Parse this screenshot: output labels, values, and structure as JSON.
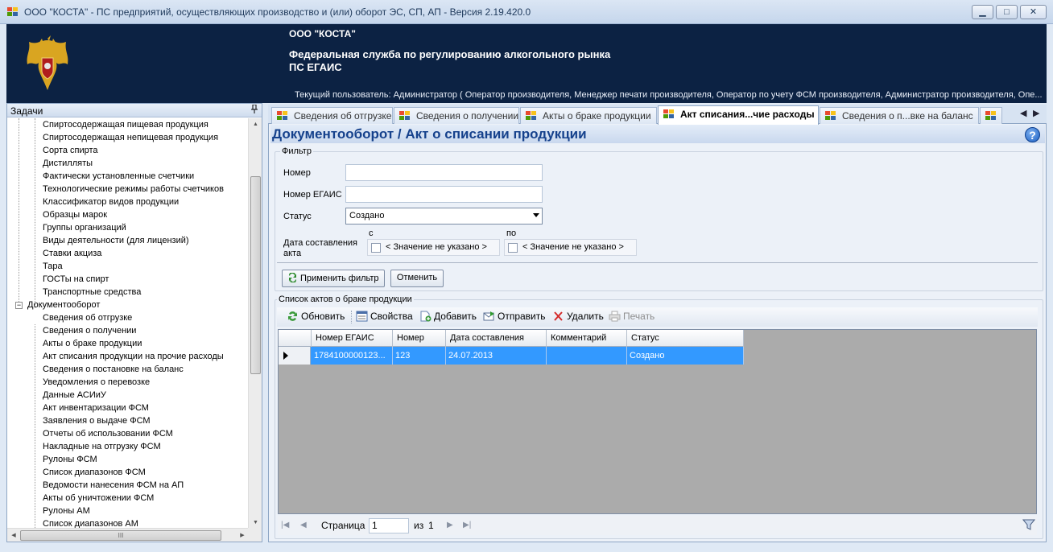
{
  "window": {
    "title": "ООО \"КОСТА\" - ПС предприятий, осуществляющих производство и (или) оборот ЭС, СП, АП - Версия 2.19.420.0",
    "minimize_glyph": "▁",
    "maximize_glyph": "□",
    "close_glyph": "✕"
  },
  "banner": {
    "company": "ООО \"КОСТА\"",
    "agency_line1": "Федеральная служба по регулированию алкогольного рынка",
    "agency_line2": "ПС ЕГАИС",
    "user_line": "Текущий пользователь: Администратор ( Оператор производителя, Менеджер печати производителя, Оператор по учету ФСМ производителя, Администратор производителя, Опе..."
  },
  "left_panel": {
    "header": "Задачи",
    "pin_glyph": "📌",
    "items": [
      "Спиртосодержащая пищевая продукция",
      "Спиртосодержащая непищевая продукция",
      "Сорта спирта",
      "Дистилляты",
      "Фактически установленные счетчики",
      "Технологические режимы работы счетчиков",
      "Классификатор видов продукции",
      "Образцы марок",
      "Группы организаций",
      "Виды деятельности (для лицензий)",
      "Ставки акциза",
      "Тара",
      "ГОСТы на спирт",
      "Транспортные средства"
    ],
    "group": {
      "label": "Документооборот",
      "expander": "−"
    },
    "group_items": [
      "Сведения об отгрузке",
      "Сведения о получении",
      "Акты о браке продукции",
      "Акт списания продукции на прочие расходы",
      "Сведения о постановке на баланс",
      "Уведомления о перевозке",
      "Данные АСИиУ",
      "Акт инвентаризации ФСМ",
      "Заявления о выдаче ФСМ",
      "Отчеты об использовании ФСМ",
      "Накладные на отгрузку ФСМ",
      "Рулоны ФСМ",
      "Список диапазонов ФСМ",
      "Ведомости нанесения ФСМ на АП",
      "Акты об уничтожении ФСМ",
      "Рулоны АМ",
      "Список диапазонов АМ"
    ],
    "scroll_up": "▲",
    "scroll_down": "▼",
    "scroll_left": "◀",
    "scroll_right": "▶",
    "hthumb_grip": "III"
  },
  "tabs": [
    {
      "label": "Сведения об отгрузке",
      "active": false
    },
    {
      "label": "Сведения о получении",
      "active": false
    },
    {
      "label": "Акты о браке продукции",
      "active": false
    },
    {
      "label": "Акт списания...чие расходы",
      "active": true
    },
    {
      "label": "Сведения о п...вке на баланс",
      "active": false
    }
  ],
  "tab_nav": {
    "prev": "◀",
    "next": "▶"
  },
  "page": {
    "title": "Документооборот / Акт о списании продукции",
    "help_glyph": "?"
  },
  "filter": {
    "legend": "Фильтр",
    "number_label": "Номер",
    "number_value": "",
    "egais_label": "Номер ЕГАИС",
    "egais_value": "",
    "status_label": "Статус",
    "status_value": "Создано",
    "date_label": "Дата составления акта",
    "from_label": "с",
    "to_label": "по",
    "date_from": "< Значение не указано >",
    "date_to": "< Значение не указано >",
    "apply_button": "Применить фильтр",
    "cancel_button": "Отменить"
  },
  "list": {
    "legend": "Список актов о браке продукции",
    "toolbar": {
      "refresh": "Обновить",
      "properties": "Свойства",
      "add": "Добавить",
      "send": "Отправить",
      "delete": "Удалить",
      "print": "Печать"
    },
    "columns": [
      "Номер ЕГАИС",
      "Номер",
      "Дата составления",
      "Комментарий",
      "Статус"
    ],
    "rows": [
      {
        "egais": "1784100000123...",
        "number": "123",
        "date": "24.07.2013",
        "comment": "",
        "status": "Создано"
      }
    ]
  },
  "pager": {
    "page_label": "Страница",
    "page_value": "1",
    "of_label": "из",
    "total": "1",
    "first": "|◀",
    "prev": "◀",
    "next": "▶",
    "last": "▶|"
  },
  "colors": {
    "banner_bg": "#0c2243",
    "title_blue": "#15418c",
    "selection": "#3399ff"
  }
}
